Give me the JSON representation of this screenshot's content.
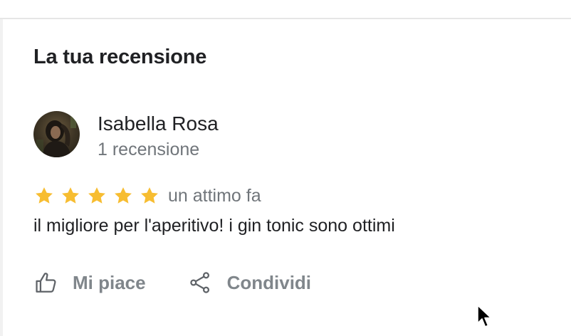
{
  "section": {
    "title": "La tua recensione"
  },
  "review": {
    "author_name": "Isabella Rosa",
    "author_meta": "1 recensione",
    "rating": 5,
    "rating_max": 5,
    "time": "un attimo fa",
    "text": "il migliore per l'aperitivo! i gin tonic sono ottimi"
  },
  "actions": {
    "like_label": "Mi piace",
    "share_label": "Condividi"
  },
  "icons": {
    "like": "thumbs-up-icon",
    "share": "share-icon",
    "star": "star-icon",
    "cursor": "mouse-pointer-icon"
  },
  "colors": {
    "star": "#f7bd31",
    "title": "#202124",
    "secondary_text": "#70757a",
    "action_text": "#80868b"
  }
}
